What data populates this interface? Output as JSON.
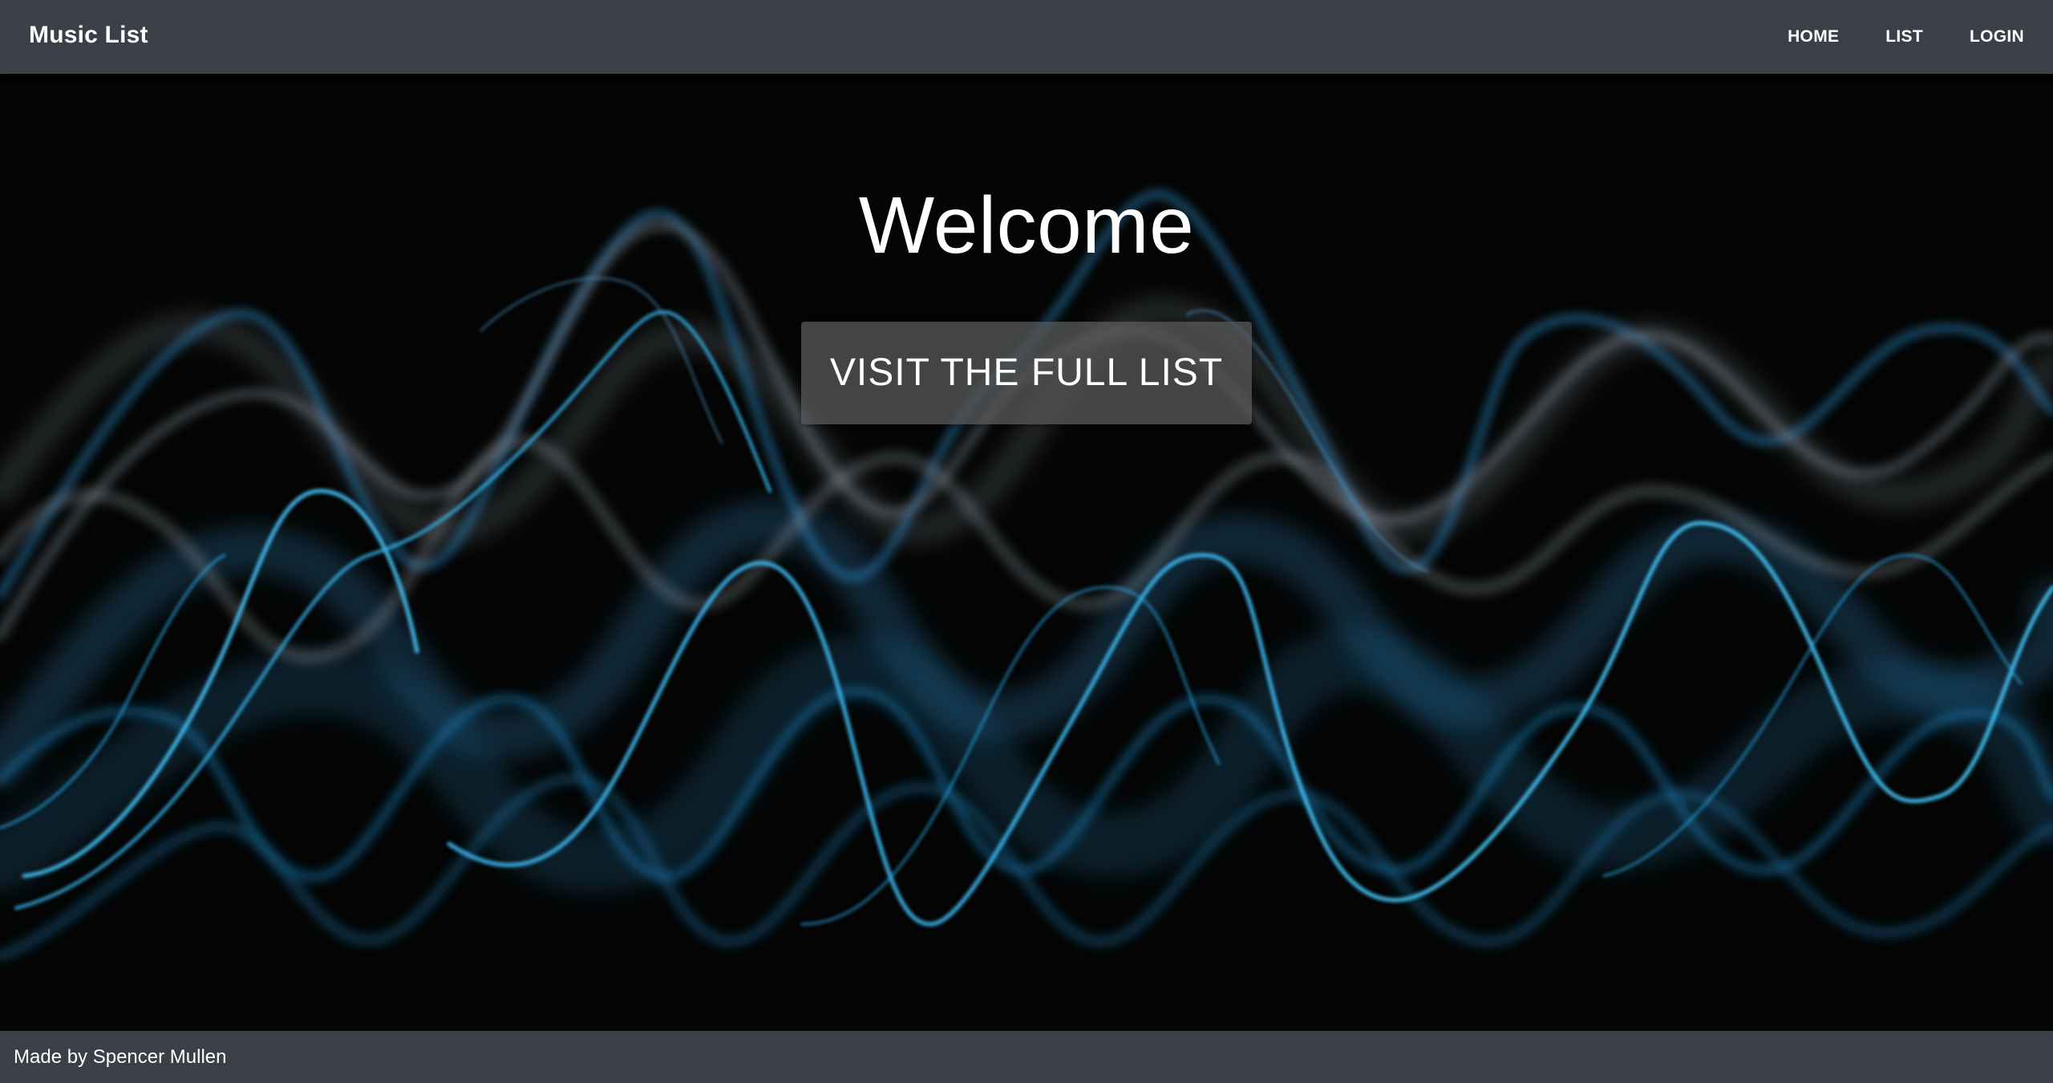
{
  "header": {
    "brand": "Music List",
    "nav": [
      "HOME",
      "LIST",
      "LOGIN"
    ]
  },
  "hero": {
    "title": "Welcome",
    "button_label": "VISIT THE FULL LIST",
    "background_image": "blue-light-sound-waves"
  },
  "footer": {
    "text": "Made by Spencer Mullen"
  },
  "colors": {
    "navbar": "#3a3f48",
    "hero_background": "#030403",
    "wave_accent": "#2aa9e8",
    "button_background": "#5a5a5a"
  }
}
